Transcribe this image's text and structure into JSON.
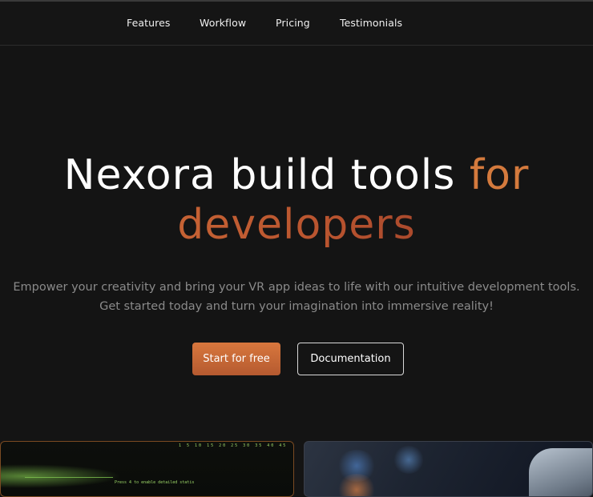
{
  "nav": {
    "items": [
      {
        "label": "Features"
      },
      {
        "label": "Workflow"
      },
      {
        "label": "Pricing"
      },
      {
        "label": "Testimonials"
      }
    ]
  },
  "hero": {
    "title_main": "Nexora build tools ",
    "title_accent_1": "for",
    "title_accent_2": "developers",
    "subtitle_line1": "Empower your creativity and bring your VR app ideas to life with our intuitive development tools.",
    "subtitle_line2": "Get started today and turn your imagination into immersive reality!",
    "primary_button": "Start for free",
    "secondary_button": "Documentation"
  },
  "preview": {
    "terminal_numbers": "1  5  10  15  20  25  30  35  40  45",
    "terminal_text": "Press 4 to enable detailed statis"
  },
  "colors": {
    "background": "#141414",
    "accent": "#d4733a",
    "accent_dark": "#8e3527",
    "muted_text": "#8a8a8a"
  }
}
